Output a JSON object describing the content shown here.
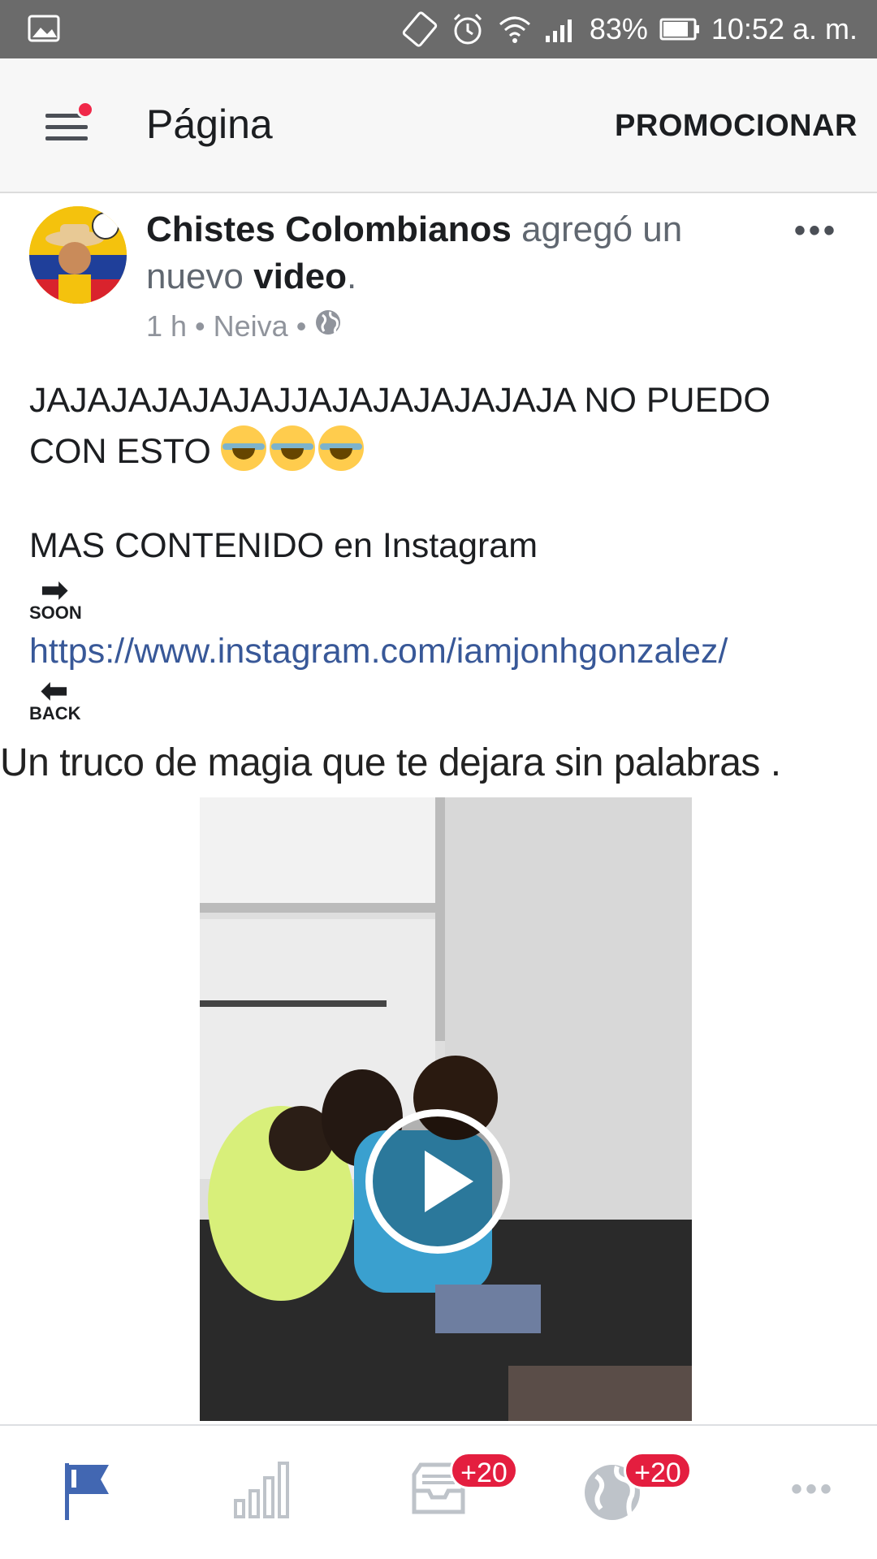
{
  "status_bar": {
    "battery": "83%",
    "time": "10:52 a. m."
  },
  "app_bar": {
    "title": "Página",
    "action": "PROMOCIONAR"
  },
  "post": {
    "page_name": "Chistes Colombianos",
    "action_text_1": " agregó un nuevo ",
    "action_bold": "video",
    "action_end": ".",
    "time": "1 h",
    "location": "Neiva",
    "separator": "•",
    "line1": "JAJAJAJAJAJAJJAJAJAJAJAJAJA NO PUEDO CON ESTO",
    "line2": "MAS CONTENIDO en Instagram",
    "soon_label": "SOON",
    "link": "https://www.instagram.com/iamjonhgonzalez/",
    "back_label": "BACK",
    "video_caption": "Un truco de magia que te dejara sin palabras ."
  },
  "bottom_nav": {
    "inbox_badge": "+20",
    "notifications_badge": "+20"
  },
  "colors": {
    "status_bar": "#6b6b6b",
    "link": "#385898",
    "badge": "#e41e3f",
    "nav_active": "#4267b2",
    "nav_inactive": "#bec3c9"
  }
}
